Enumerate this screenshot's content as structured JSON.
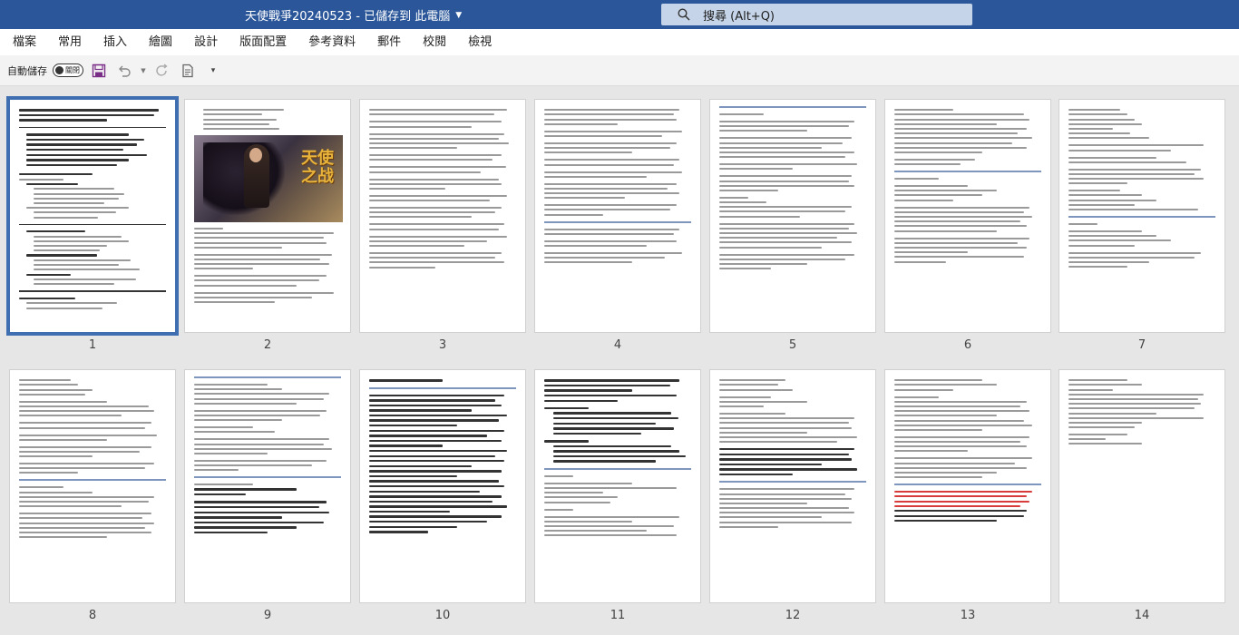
{
  "titlebar": {
    "doc_title": "天使戰爭20240523 - 已儲存到 此電腦",
    "search_placeholder": "搜尋 (Alt+Q)"
  },
  "menu": [
    "檔案",
    "常用",
    "插入",
    "繪圖",
    "設計",
    "版面配置",
    "參考資料",
    "郵件",
    "校閱",
    "檢視"
  ],
  "toolbar": {
    "autosave_label": "自動儲存",
    "autosave_state": "關閉"
  },
  "cover": {
    "logo_text": "天使之战"
  },
  "pages": [
    {
      "number": "1"
    },
    {
      "number": "2"
    },
    {
      "number": "3"
    },
    {
      "number": "4"
    },
    {
      "number": "5"
    },
    {
      "number": "6"
    },
    {
      "number": "7"
    },
    {
      "number": "8"
    },
    {
      "number": "9"
    },
    {
      "number": "10"
    },
    {
      "number": "11"
    },
    {
      "number": "12"
    },
    {
      "number": "13"
    },
    {
      "number": "14"
    }
  ],
  "selected_page": "1",
  "colors": {
    "titlebar": "#2b579a",
    "selection": "#3f6fb0",
    "background": "#e6e6e6"
  }
}
